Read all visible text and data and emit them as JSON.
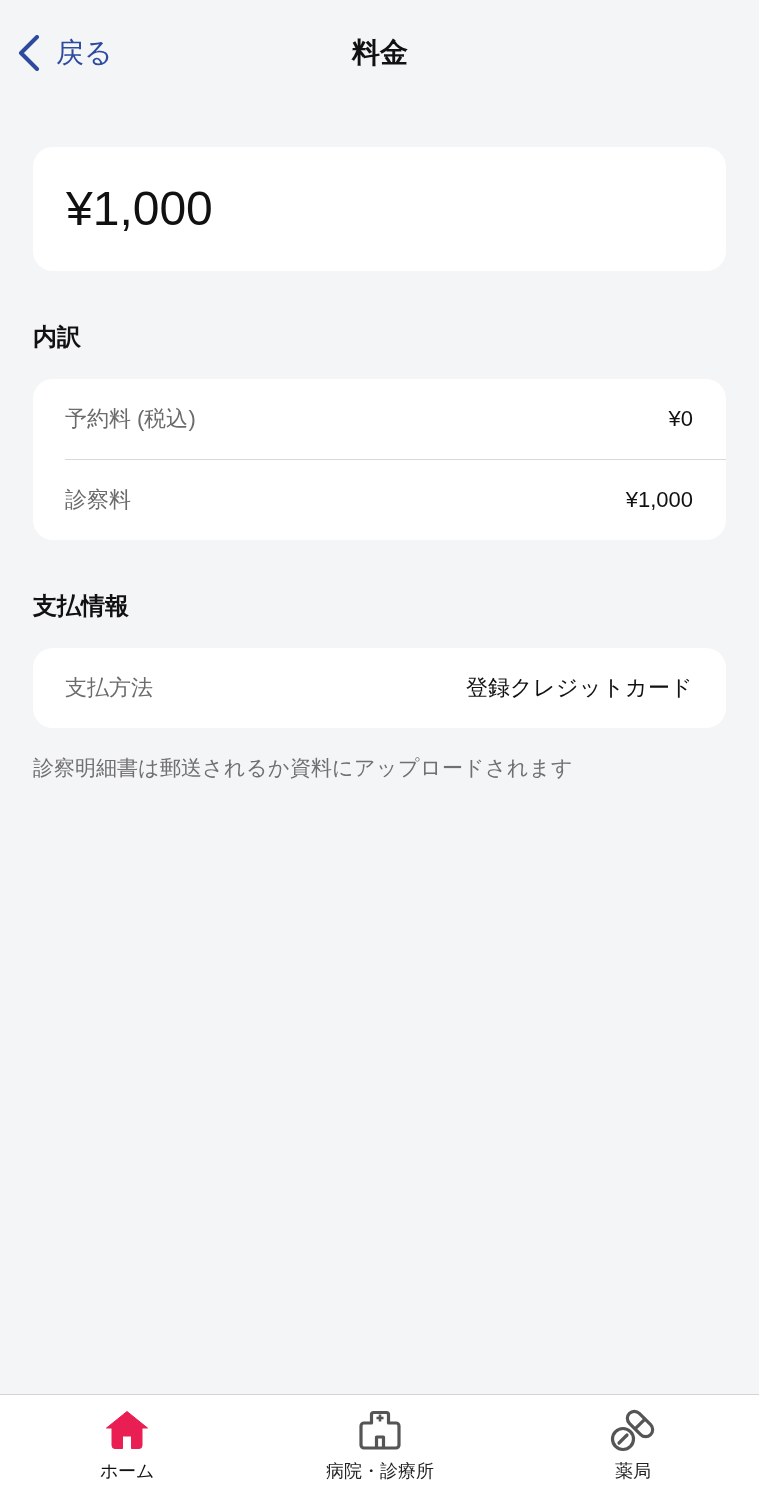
{
  "header": {
    "back": {
      "label": "戻る"
    },
    "title": "料金"
  },
  "total": {
    "amount": "¥1,000"
  },
  "sections": [
    {
      "heading": "内訳",
      "rows": [
        {
          "label": "予約料 (税込)",
          "value": "¥0"
        },
        {
          "label": "診察料",
          "value": "¥1,000"
        }
      ]
    },
    {
      "heading": "支払情報",
      "rows": [
        {
          "label": "支払方法",
          "value": "登録クレジットカード"
        }
      ]
    }
  ],
  "note": "診察明細書は郵送されるか資料にアップロードされます",
  "tab_bar": {
    "tabs": [
      {
        "label": "ホーム",
        "selected": true
      },
      {
        "label": "病院・診療所",
        "selected": false
      },
      {
        "label": "薬局",
        "selected": false
      }
    ]
  }
}
